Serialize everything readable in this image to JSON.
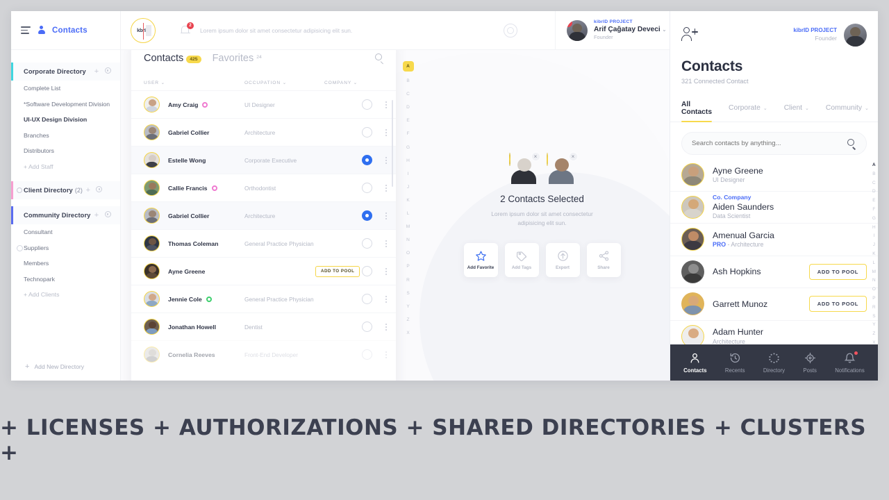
{
  "sidebar": {
    "brand": "Contacts",
    "menu_icon": "hamburger-icon",
    "groups": [
      {
        "title": "Corporate Directory",
        "count": "",
        "color": "#3fd6e0",
        "items": [
          {
            "label": "Complete List",
            "style": "normal"
          },
          {
            "label": "*Software Development Division",
            "style": "normal"
          },
          {
            "label": "UI-UX Design Division",
            "style": "strong"
          },
          {
            "label": "Branches",
            "style": "normal"
          },
          {
            "label": "Distributors",
            "style": "normal"
          },
          {
            "label": "+ Add Staff",
            "style": "muted"
          }
        ]
      },
      {
        "title": "Client Directory",
        "count": "(2)",
        "color": "#f79fd0",
        "items": []
      },
      {
        "title": "Community Directory",
        "count": "",
        "color": "#5a6cf0",
        "items": [
          {
            "label": "Consultant",
            "style": "normal"
          },
          {
            "label": "Suppliers",
            "style": "dot"
          },
          {
            "label": "Members",
            "style": "normal"
          },
          {
            "label": "Technopark",
            "style": "normal"
          },
          {
            "label": "+ Add Clients",
            "style": "muted"
          }
        ]
      }
    ],
    "add_directory": "Add New Directory"
  },
  "topbar": {
    "logo_text": "kbrID",
    "notification_count": "2",
    "lorem": "Lorem ipsum dolor sit amet consectetur adipisicing elit sun.",
    "help_icon": "lifebuoy-icon",
    "profile": {
      "badge": "6",
      "project": "kibrID PROJECT",
      "name": "Arif Çağatay Deveci",
      "role": "Founder",
      "caret": "⌄"
    }
  },
  "contacts_card": {
    "tab_contacts": "Contacts",
    "tab_contacts_badge": "425",
    "tab_favorites": "Favorites",
    "tab_favorites_count": "24",
    "columns": {
      "user": "USER",
      "occupation": "OCCUPATION",
      "company": "COMPANY"
    },
    "pool_label": "ADD TO POOL",
    "rows": [
      {
        "name": "Amy Craig",
        "occupation": "UI Designer",
        "status": "pink",
        "selected": false,
        "pool": false,
        "fade": false,
        "skin": "#c8a286",
        "shirt": "#cfd5e0",
        "ring": "#f0f0ee"
      },
      {
        "name": "Gabriel Collier",
        "occupation": "Architecture",
        "status": "",
        "selected": false,
        "pool": false,
        "fade": false,
        "skin": "#9b8676",
        "shirt": "#6d6f78",
        "ring": "#b9bcc4"
      },
      {
        "name": "Estelle Wong",
        "occupation": "Corporate Executive",
        "status": "",
        "selected": true,
        "pool": false,
        "fade": false,
        "skin": "#d6cdc5",
        "shirt": "#3e4048",
        "ring": "#e4e1dd"
      },
      {
        "name": "Callie Francis",
        "occupation": "Orthodontist",
        "status": "pink",
        "selected": false,
        "pool": false,
        "fade": false,
        "skin": "#9a7a5c",
        "shirt": "#4f6d55",
        "ring": "#7e9a72"
      },
      {
        "name": "Gabriel Collier",
        "occupation": "Architecture",
        "status": "",
        "selected": true,
        "pool": false,
        "fade": false,
        "skin": "#9b8676",
        "shirt": "#6d6f78",
        "ring": "#b9bcc4"
      },
      {
        "name": "Thomas Coleman",
        "occupation": "General Practice Physician",
        "status": "",
        "selected": false,
        "pool": false,
        "fade": false,
        "skin": "#6d5544",
        "shirt": "#4d5260",
        "ring": "#2e3644"
      },
      {
        "name": "Ayne Greene",
        "occupation": "",
        "status": "",
        "selected": false,
        "pool": true,
        "fade": false,
        "skin": "#8a6a4e",
        "shirt": "#5d4a36",
        "ring": "#3a3129"
      },
      {
        "name": "Jennie Cole",
        "occupation": "General Practice Physician",
        "status": "green",
        "selected": false,
        "pool": false,
        "fade": false,
        "skin": "#d1a98a",
        "shirt": "#8ea8c4",
        "ring": "#d8dde4"
      },
      {
        "name": "Jonathan Howell",
        "occupation": "Dentist",
        "status": "",
        "selected": false,
        "pool": false,
        "fade": false,
        "skin": "#5c4334",
        "shirt": "#7e9cc0",
        "ring": "#6e5f50"
      },
      {
        "name": "Cornelia Reeves",
        "occupation": "Front-End Developer",
        "status": "",
        "selected": false,
        "pool": false,
        "fade": true,
        "skin": "#b9b4ae",
        "shirt": "#9a9a9c",
        "ring": "#d4d2cf"
      }
    ]
  },
  "alphabet_rail": [
    "A",
    "B",
    "C",
    "D",
    "E",
    "F",
    "G",
    "H",
    "I",
    "J",
    "K",
    "L",
    "M",
    "N",
    "O",
    "P",
    "R",
    "S",
    "Y",
    "Z",
    "X"
  ],
  "alphabet_active": "A",
  "selection_pane": {
    "title": "2 Contacts Selected",
    "subtitle": "Lorem ipsum dolor sit amet consectetur adipisicing elit sun.",
    "close_glyph": "×",
    "avatars": [
      {
        "skin": "#d8d2cb",
        "shirt": "#2f3138",
        "name": "selected-contact-1"
      },
      {
        "skin": "#a5846a",
        "shirt": "#6d7684",
        "name": "selected-contact-2"
      }
    ],
    "actions": [
      {
        "label": "Add Favorite",
        "icon": "star-icon",
        "active": true
      },
      {
        "label": "Add Tags",
        "icon": "tag-icon",
        "active": false
      },
      {
        "label": "Export",
        "icon": "upload-icon",
        "active": false
      },
      {
        "label": "Share",
        "icon": "share-icon",
        "active": false
      }
    ]
  },
  "mobile": {
    "add_user_icon": "add-user-icon",
    "owner": {
      "project": "kibrID PROJECT",
      "role": "Founder"
    },
    "heading": "Contacts",
    "subheading": "321 Connected Contact",
    "tabs": [
      {
        "label": "All Contacts",
        "caret": "",
        "active": true
      },
      {
        "label": "Corporate",
        "caret": "⌄",
        "active": false
      },
      {
        "label": "Client",
        "caret": "⌄",
        "active": false
      },
      {
        "label": "Community",
        "caret": "⌄",
        "active": false
      }
    ],
    "search_placeholder": "Search contacts by anything...",
    "search_value": "",
    "pool_label": "ADD TO POOL",
    "rows": [
      {
        "company": "",
        "name": "Ayne Greene",
        "occupation": "UI Designer",
        "pro": "",
        "pool": false,
        "ring": true,
        "skin": "#c8a07c",
        "shirt": "#8e8878",
        "bg": "#b6a994"
      },
      {
        "company": "Co. Company",
        "name": "Aiden Saunders",
        "occupation": "Data Scientist",
        "pro": "",
        "pool": false,
        "ring": true,
        "skin": "#d4a878",
        "shirt": "#d8d4cc",
        "bg": "#cdc7bd"
      },
      {
        "company": "",
        "name": "Amenual Garcia",
        "occupation": "Architecture",
        "pro": "PRO",
        "pool": false,
        "ring": true,
        "skin": "#c08c66",
        "shirt": "#3d3a42",
        "bg": "#6b5e55"
      },
      {
        "company": "",
        "name": "Ash Hopkins",
        "occupation": "",
        "pro": "",
        "pool": true,
        "ring": false,
        "skin": "#8e8e8e",
        "shirt": "#3a3a3a",
        "bg": "#5f5f5f"
      },
      {
        "company": "",
        "name": "Garrett Munoz",
        "occupation": "",
        "pro": "",
        "pool": true,
        "ring": false,
        "skin": "#d8a978",
        "shirt": "#7e93ad",
        "bg": "#e0b45a"
      },
      {
        "company": "",
        "name": "Adam Hunter",
        "occupation": "Architecture",
        "pro": "",
        "pool": false,
        "ring": true,
        "skin": "#d9ab82",
        "shirt": "#ececee",
        "bg": "#efeeec"
      }
    ],
    "rail": [
      "A",
      "B",
      "C",
      "D",
      "E",
      "F",
      "G",
      "H",
      "I",
      "J",
      "K",
      "L",
      "M",
      "N",
      "O",
      "P",
      "R",
      "S",
      "Y",
      "Z",
      "X"
    ],
    "rail_active": "A",
    "nav": [
      {
        "label": "Contacts",
        "icon": "person-icon",
        "active": true,
        "dot": false
      },
      {
        "label": "Recents",
        "icon": "clock-icon",
        "active": false,
        "dot": false
      },
      {
        "label": "Directory",
        "icon": "dotted-ring-icon",
        "active": false,
        "dot": false
      },
      {
        "label": "Posts",
        "icon": "target-icon",
        "active": false,
        "dot": false
      },
      {
        "label": "Notifications",
        "icon": "bell-icon",
        "active": false,
        "dot": true
      }
    ]
  },
  "caption": "+ LICENSES + AUTHORIZATIONS + SHARED DIRECTORIES + CLUSTERS +"
}
